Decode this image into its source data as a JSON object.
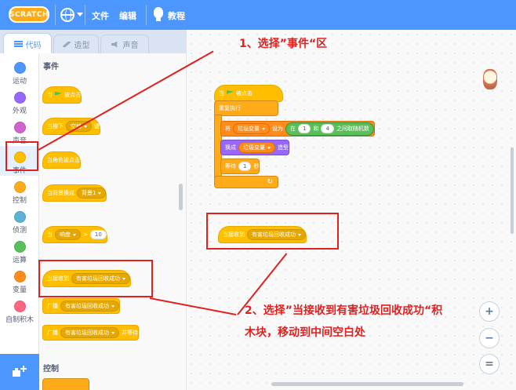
{
  "topbar": {
    "logo": "SCRATCH",
    "menu_file": "文件",
    "menu_edit": "编辑",
    "menu_tutorials": "教程"
  },
  "tabs": [
    {
      "label": "代码",
      "icon": "code-icon",
      "active": true
    },
    {
      "label": "造型",
      "icon": "brush-icon",
      "active": false
    },
    {
      "label": "声音",
      "icon": "speaker-icon",
      "active": false
    }
  ],
  "categories": [
    {
      "label": "运动",
      "color": "#4c97ff"
    },
    {
      "label": "外观",
      "color": "#9966ff"
    },
    {
      "label": "声音",
      "color": "#cf63cf"
    },
    {
      "label": "事件",
      "color": "#ffbf00",
      "selected": true
    },
    {
      "label": "控制",
      "color": "#ffab19"
    },
    {
      "label": "侦测",
      "color": "#5cb1d6"
    },
    {
      "label": "运算",
      "color": "#59c059"
    },
    {
      "label": "变量",
      "color": "#ff8c1a"
    },
    {
      "label": "自制积木",
      "color": "#ff6680"
    }
  ],
  "palette": {
    "section_events": "事件",
    "section_control": "控制",
    "when_flag": "当",
    "when_flag_suffix": "被点击",
    "when_key": "当按下",
    "key_value": "空格",
    "key_suffix": "键",
    "when_sprite_clicked": "当角色被点击",
    "when_backdrop": "当背景换成",
    "backdrop_value": "背景1",
    "when_sensor": "当",
    "sensor_value": "响度",
    "sensor_num": "10",
    "when_receive": "当接收到",
    "receive_value": "有害垃圾回收成功",
    "broadcast": "广播",
    "broadcast_value": "有害垃圾回收成功",
    "broadcast_wait": "广播",
    "broadcast_wait_value": "有害垃圾回收成功",
    "broadcast_wait_suffix": "并等待"
  },
  "script1": {
    "hat": "当",
    "hat_suffix": "被点击",
    "forever": "重复执行",
    "set_prefix": "将",
    "set_var": "垃圾变量",
    "set_to": "设为",
    "rand_prefix": "在",
    "rand_from": "1",
    "rand_and": "和",
    "rand_to": "4",
    "rand_suffix": "之间取随机数",
    "switch_prefix": "换成",
    "switch_var": "垃圾变量",
    "switch_suffix": "造型",
    "wait_prefix": "等待",
    "wait_value": "1",
    "wait_suffix": "秒"
  },
  "script2": {
    "label": "当接收到",
    "value": "有害垃圾回收成功"
  },
  "annotations": {
    "step1": "1、选择”事件“区",
    "step2_line1": "2、选择”当接收到有害垃圾回收成功“积",
    "step2_line2": "木块，移动到中间空白处"
  },
  "zoom": {
    "zoom_in": "+",
    "zoom_out": "−",
    "reset": "="
  }
}
